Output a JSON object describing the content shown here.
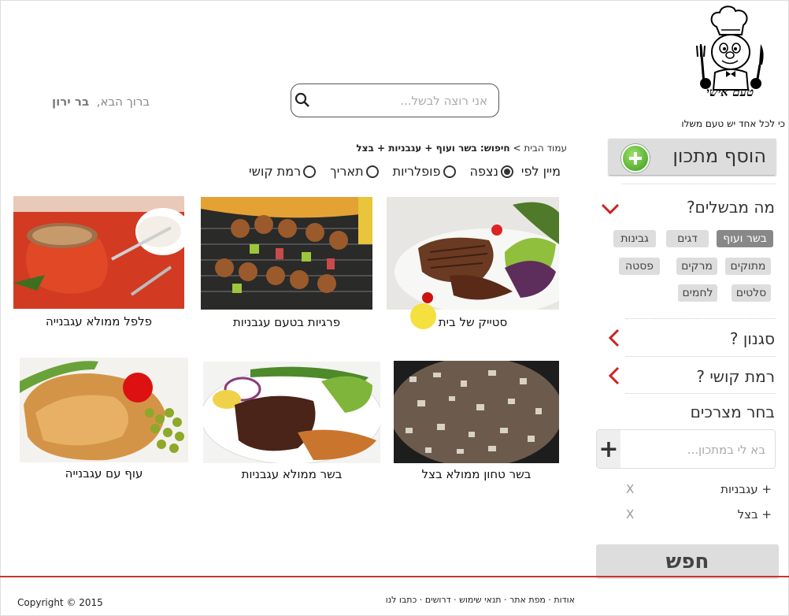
{
  "brand": {
    "name": "טעם אישי",
    "tagline": "כי לכל אחד יש טעם משלו"
  },
  "header": {
    "search_placeholder": "אני רוצה לבשל...",
    "welcome_prefix": "ברוך הבא,",
    "welcome_user": "בר ירון"
  },
  "breadcrumb": {
    "home": "עמוד הבית",
    "separator": ">",
    "query": "חיפוש: בשר ועוף + עגבניות + בצל"
  },
  "sort": {
    "label": "מיין לפי",
    "options": [
      "נצפה",
      "פופלריות",
      "תאריך",
      "רמת קושי"
    ],
    "selected": "נצפה"
  },
  "recipes": [
    {
      "title": "סטייק של בית",
      "image": "steak-photo"
    },
    {
      "title": "פרגיות בטעם עגבניות",
      "image": "skewers-photo"
    },
    {
      "title": "פלפל ממולא עגבנייה",
      "image": "stuffed-pepper-photo"
    },
    {
      "title": "בשר טחון ממולא בצל",
      "image": "ground-meat-photo"
    },
    {
      "title": "בשר ממולא עגבניות",
      "image": "meat-plate-photo"
    },
    {
      "title": "עוף עם עגבנייה",
      "image": "chicken-photo"
    }
  ],
  "sidebar": {
    "add_recipe": "הוסף מתכון",
    "what_cooking": "מה מבשלים?",
    "categories": [
      "בשר ועוף",
      "דגים",
      "גבינות",
      "מתוקים",
      "מרקים",
      "פסטה",
      "סלטים",
      "לחמים"
    ],
    "active_category": "בשר ועוף",
    "style": "סגנון ?",
    "difficulty": "רמת קושי ?",
    "choose_ingredients": "בחר מצרכים",
    "ingredient_placeholder": "בא לי במתכון...",
    "selected_ingredients": [
      "+ עגבניות",
      "+ בצל"
    ],
    "remove_label": "X",
    "search_button": "חפש"
  },
  "footer": {
    "links": [
      "אודות",
      "מפת אתר",
      "תנאי שימוש",
      "דרושים",
      "כתבו לנו"
    ],
    "copyright": "Copyright © 2015"
  },
  "colors": {
    "accent_red": "#cc2222",
    "tag_active": "#888888",
    "highlight_dot": "#f4e03f"
  }
}
